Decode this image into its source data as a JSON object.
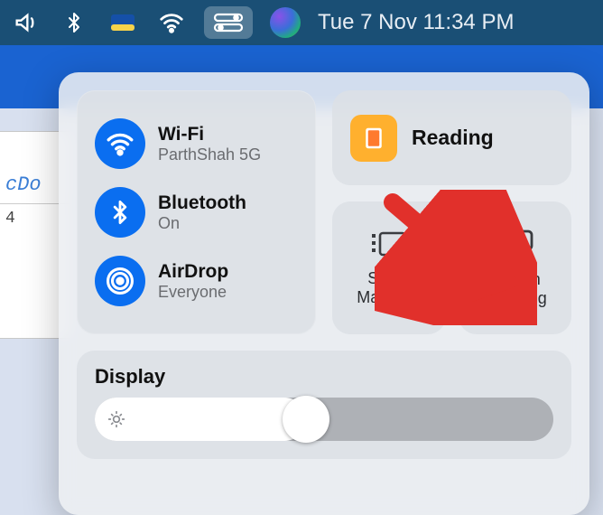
{
  "menubar": {
    "datetime": "Tue 7 Nov  11:34 PM"
  },
  "bgwin": {
    "header": "cDo",
    "row1": "4"
  },
  "controlCenter": {
    "wifi": {
      "title": "Wi-Fi",
      "sub": "ParthShah 5G"
    },
    "bluetooth": {
      "title": "Bluetooth",
      "sub": "On"
    },
    "airdrop": {
      "title": "AirDrop",
      "sub": "Everyone"
    },
    "focus": {
      "label": "Reading"
    },
    "stageManager": {
      "label": "Stage\nManager"
    },
    "screenMirroring": {
      "label": "Screen\nMirroring"
    },
    "display": {
      "title": "Display",
      "brightnessPct": 46
    }
  }
}
